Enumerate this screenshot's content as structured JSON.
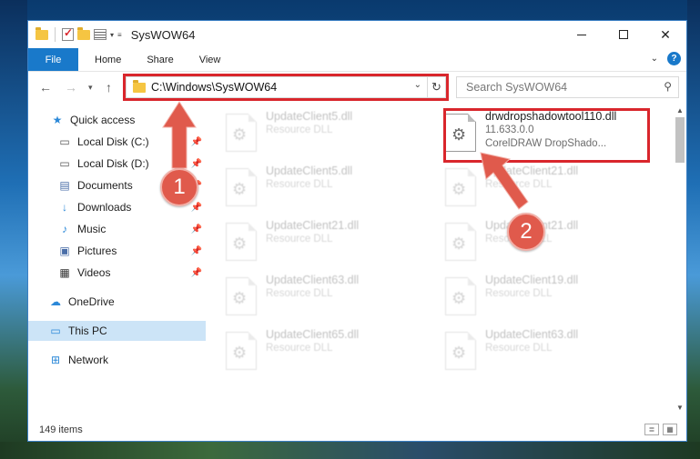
{
  "window": {
    "title": "SysWOW64"
  },
  "ribbon": {
    "tabs": [
      "File",
      "Home",
      "Share",
      "View"
    ]
  },
  "address": {
    "path": "C:\\Windows\\SysWOW64"
  },
  "search": {
    "placeholder": "Search SysWOW64"
  },
  "nav": {
    "quick_access": "Quick access",
    "items": [
      {
        "label": "Local Disk (C:)",
        "icon": "drive-icon",
        "pinned": true
      },
      {
        "label": "Local Disk (D:)",
        "icon": "drive-icon",
        "pinned": true
      },
      {
        "label": "Documents",
        "icon": "documents-icon",
        "pinned": true
      },
      {
        "label": "Downloads",
        "icon": "downloads-icon",
        "pinned": true
      },
      {
        "label": "Music",
        "icon": "music-icon",
        "pinned": true
      },
      {
        "label": "Pictures",
        "icon": "pictures-icon",
        "pinned": true
      },
      {
        "label": "Videos",
        "icon": "videos-icon",
        "pinned": true
      }
    ],
    "onedrive": "OneDrive",
    "this_pc": "This PC",
    "network": "Network"
  },
  "files": {
    "highlighted": {
      "name": "drwdropshadowtool110.dll",
      "version": "11.633.0.0",
      "description": "CorelDRAW DropShado..."
    },
    "left_column": [
      {
        "name": "UpdateClient5.dll",
        "type": "Resource DLL"
      },
      {
        "name": "UpdateClient5.dll",
        "type": "Resource DLL"
      },
      {
        "name": "UpdateClient21.dll",
        "type": "Resource DLL"
      },
      {
        "name": "UpdateClient63.dll",
        "type": "Resource DLL"
      },
      {
        "name": "UpdateClient65.dll",
        "type": "Resource DLL"
      }
    ],
    "right_column": [
      {
        "name": "UpdateClient21.dll",
        "type": "Resource DLL"
      },
      {
        "name": "UpdateClient21.dll",
        "type": "Resource DLL"
      },
      {
        "name": "UpdateClient19.dll",
        "type": "Resource DLL"
      },
      {
        "name": "UpdateClient63.dll",
        "type": "Resource DLL"
      }
    ]
  },
  "status": {
    "item_count": "149 items"
  },
  "callouts": {
    "step1": "1",
    "step2": "2"
  },
  "colors": {
    "accent": "#1979ca",
    "highlight": "#d9262c",
    "callout": "#e05a4c"
  }
}
